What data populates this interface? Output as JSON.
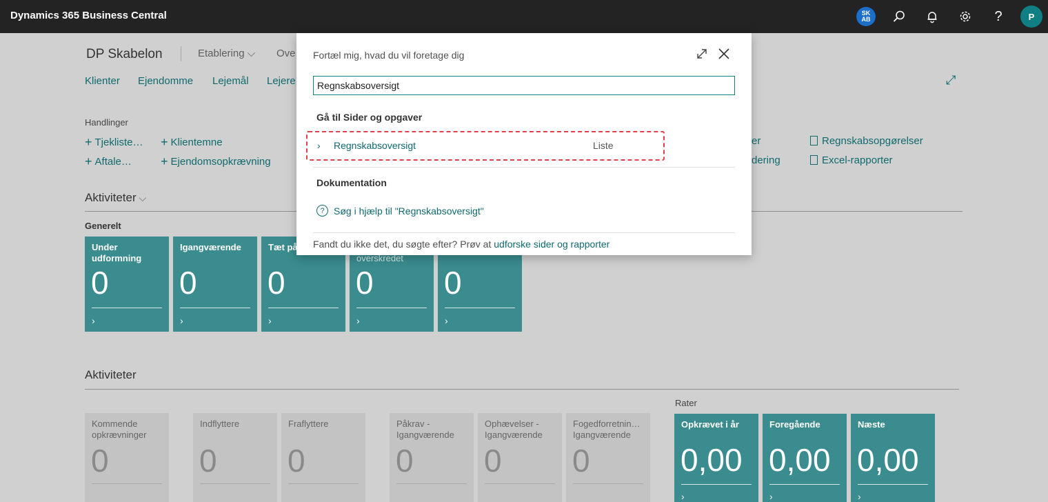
{
  "header": {
    "app_title": "Dynamics 365 Business Central",
    "company_badge": [
      "SK",
      "AB"
    ],
    "avatar_initial": "P"
  },
  "page": {
    "company": "DP Skabelon",
    "menus": [
      "Etablering",
      "Ove"
    ],
    "nav_links": [
      "Klienter",
      "Ejendomme",
      "Lejemål",
      "Lejere"
    ],
    "actions_title": "Handlinger",
    "actions_left": [
      "Tjekliste…",
      "Aftale…",
      "Klientemne",
      "Ejendomsopkrævning"
    ],
    "actions_right_partial": [
      "er",
      "dering"
    ],
    "reports": [
      "Regnskabsopgørelser",
      "Excel-rapporter"
    ]
  },
  "activities_top": {
    "title": "Aktiviteter",
    "group": "Generelt",
    "tiles": [
      {
        "label": "Under udformning",
        "value": "0"
      },
      {
        "label": "Igangværende",
        "value": "0"
      },
      {
        "label": "Tæt på",
        "value": "0"
      },
      {
        "label": "overskredet",
        "value": "0"
      },
      {
        "label": "",
        "value": "0"
      }
    ]
  },
  "activities_bottom": {
    "title": "Aktiviteter",
    "tiles": [
      {
        "label": "Kommende opkrævninger",
        "value": "0"
      },
      {
        "label": "Indflyttere",
        "value": "0"
      },
      {
        "label": "Fraflyttere",
        "value": "0"
      },
      {
        "label": "Påkrav - Igangværende",
        "value": "0"
      },
      {
        "label": "Ophævelser - Igangværende",
        "value": "0"
      },
      {
        "label": "Fogedforretnin… Igangværende",
        "value": "0"
      }
    ],
    "rates_title": "Rater",
    "rates": [
      {
        "label": "Opkrævet i år",
        "value": "0,00"
      },
      {
        "label": "Foregående",
        "value": "0,00"
      },
      {
        "label": "Næste",
        "value": "0,00"
      }
    ]
  },
  "dialog": {
    "prompt": "Fortæl mig, hvad du vil foretage dig",
    "search_value": "Regnskabsoversigt",
    "section_pages": "Gå til Sider og opgaver",
    "result_name": "Regnskabsoversigt",
    "result_type": "Liste",
    "section_docs": "Dokumentation",
    "help_link": "Søg i hjælp til \"Regnskabsoversigt\"",
    "footer_text": "Fandt du ikke det, du søgte efter? Prøv at ",
    "footer_link": "udforske sider og rapporter"
  },
  "colors": {
    "teal": "#3a8c8f",
    "link": "#0f6a6e",
    "highlight": "#e0404a"
  }
}
